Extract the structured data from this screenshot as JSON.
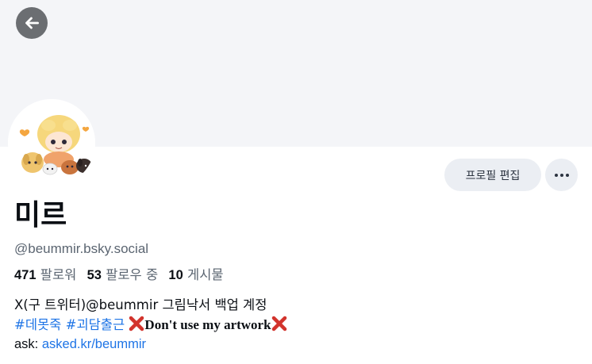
{
  "profile": {
    "display_name": "미르",
    "handle": "@beummir.bsky.social",
    "edit_button_label": "프로필 편집",
    "stats": {
      "followers_count": "471",
      "followers_label": "팔로워",
      "following_count": "53",
      "following_label": "팔로우 중",
      "posts_count": "10",
      "posts_label": "게시물"
    },
    "bio": {
      "line1": "X(구 트위터)@beummir 그림낙서 백업 계정",
      "hashtag1": "#데못죽",
      "hashtag2": "#괴담출근",
      "warning": "Don't use my artwork",
      "ask_label": "ask: ",
      "ask_link": "asked.kr/beummir"
    }
  },
  "icons": {
    "back": "arrow-left-icon",
    "more": "ellipsis-icon",
    "warning": "cross-mark-icon"
  },
  "colors": {
    "banner": "#f4f5f8",
    "button_bg": "#ebeef3",
    "link": "#1e74e6",
    "muted_text": "#5b6571",
    "back_button": "#6b6e72"
  }
}
